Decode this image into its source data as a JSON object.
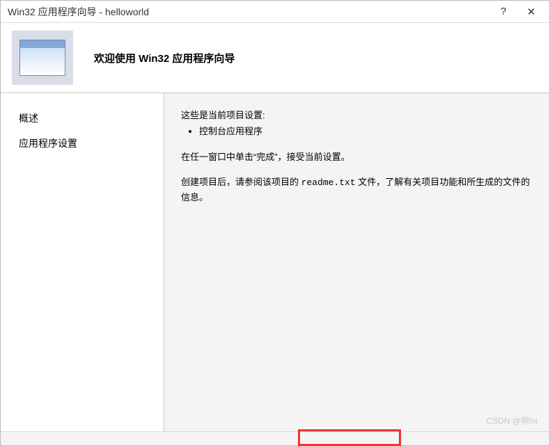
{
  "titlebar": {
    "title": "Win32 应用程序向导 - helloworld",
    "help_label": "?",
    "close_label": "✕"
  },
  "banner": {
    "heading": "欢迎使用 Win32 应用程序向导"
  },
  "sidebar": {
    "items": [
      {
        "label": "概述"
      },
      {
        "label": "应用程序设置"
      }
    ]
  },
  "content": {
    "intro_line": "这些是当前项目设置:",
    "bullets": [
      "控制台应用程序"
    ],
    "finish_line": "在任一窗口中单击“完成”，接受当前设置。",
    "readme_prefix": "创建项目后，请参阅该项目的 ",
    "readme_filename": "readme.txt",
    "readme_suffix": " 文件，了解有关项目功能和所生成的文件的信息。"
  },
  "watermark": "CSDN @啊hii"
}
